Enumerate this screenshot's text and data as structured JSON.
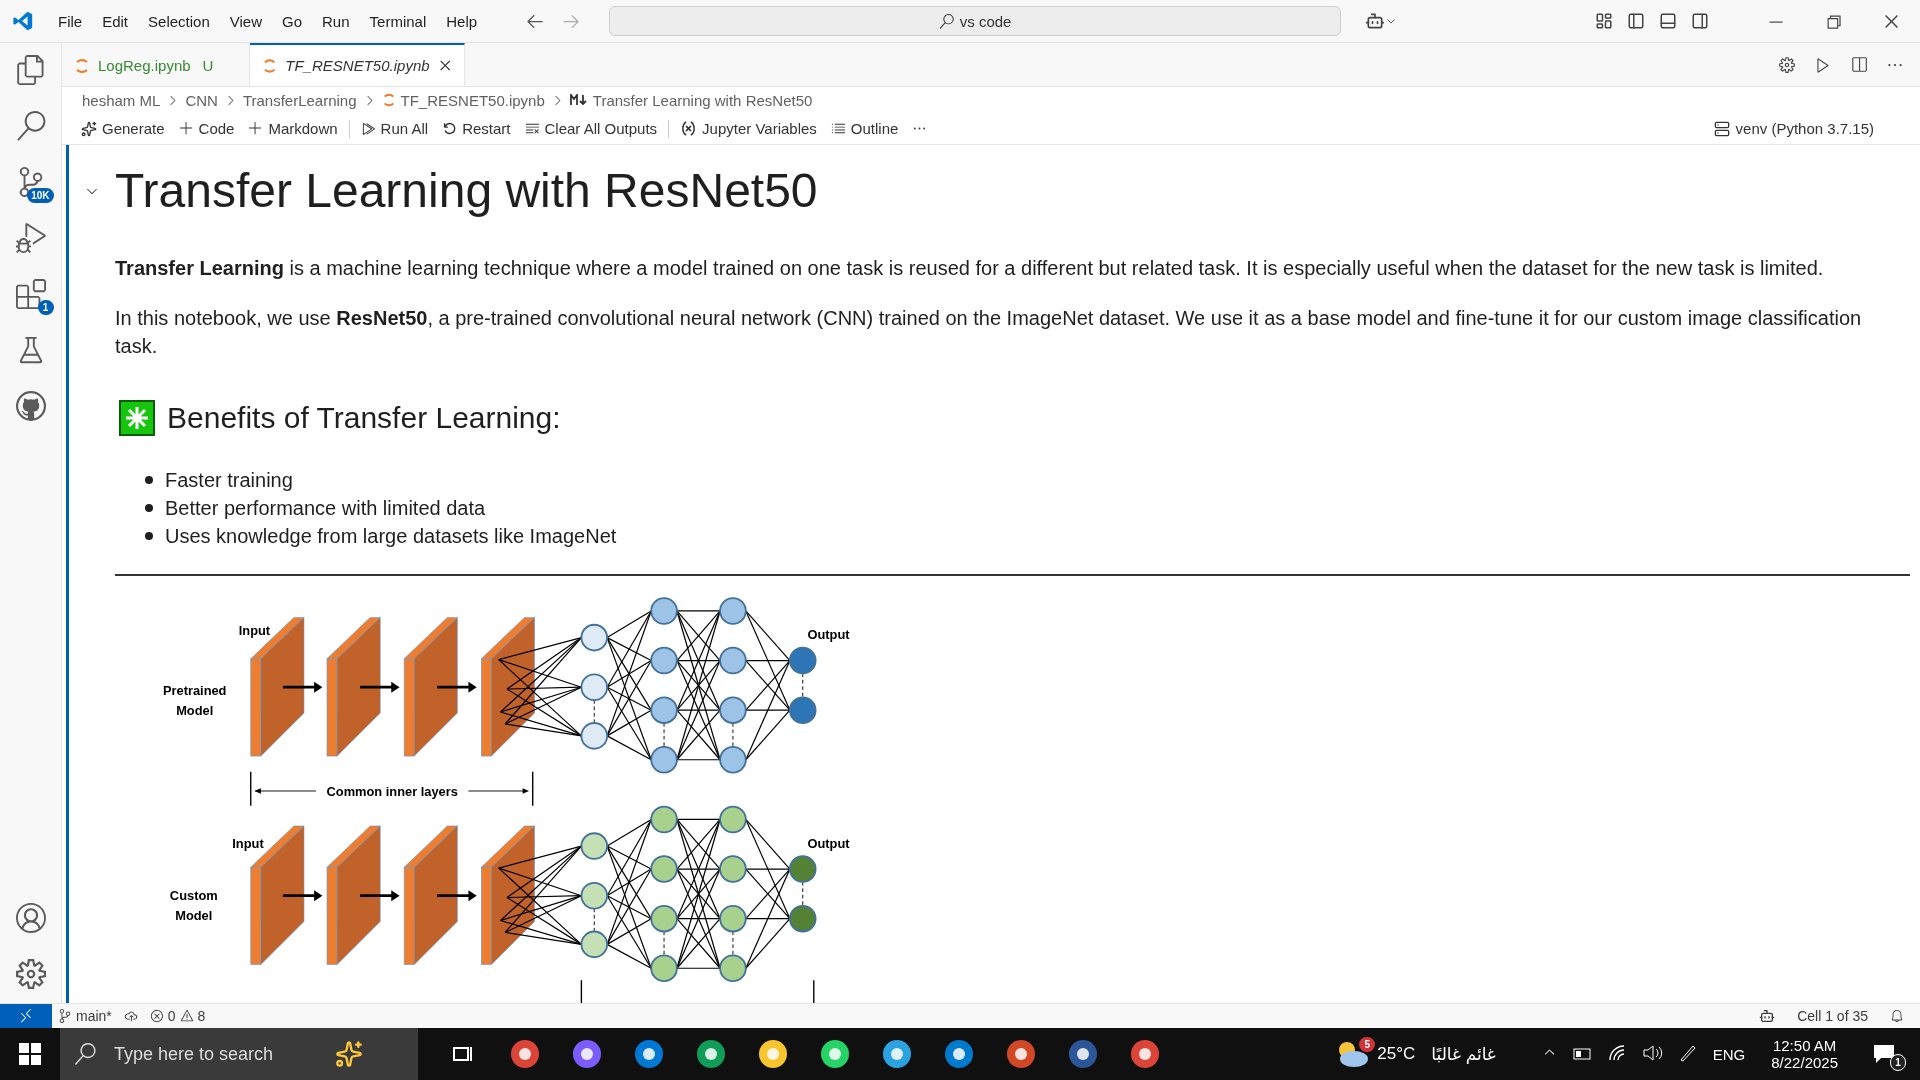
{
  "menu": [
    "File",
    "Edit",
    "Selection",
    "View",
    "Go",
    "Run",
    "Terminal",
    "Help"
  ],
  "command_center": {
    "value": "vs code"
  },
  "activity_badges": {
    "source_control": "10K",
    "extensions": "1"
  },
  "tabs": [
    {
      "label": "LogReg.ipynb",
      "badge": "U",
      "selected": false
    },
    {
      "label": "TF_RESNET50.ipynb",
      "selected": true
    }
  ],
  "breadcrumb": [
    "hesham ML",
    "CNN",
    "TransferLearning",
    "TF_RESNET50.ipynb",
    "Transfer Learning with ResNet50"
  ],
  "notebook_toolbar": [
    {
      "label": "Generate",
      "kind": "generate"
    },
    {
      "label": "Code",
      "kind": "add"
    },
    {
      "label": "Markdown",
      "kind": "add"
    },
    {
      "label": "Run All",
      "kind": "run"
    },
    {
      "label": "Restart",
      "kind": "restart"
    },
    {
      "label": "Clear All Outputs",
      "kind": "clear"
    },
    {
      "label": "Jupyter Variables",
      "kind": "variables"
    },
    {
      "label": "Outline",
      "kind": "outline"
    }
  ],
  "kernel": "venv (Python 3.7.15)",
  "cell": {
    "heading": "Transfer Learning with ResNet50",
    "paragraphs": [
      "**Transfer Learning** is a machine learning technique where a model trained on one task is reused for a different but related task. It is especially useful when the dataset for the new task is limited.",
      "In this notebook, we use **ResNet50**, a pre-trained convolutional neural network (CNN) trained on the ImageNet dataset. We use it as a base model and fine-tune it for our custom image classification task."
    ],
    "subheading": "Benefits of Transfer Learning:",
    "bullets": [
      "Faster training",
      "Better performance with limited data",
      "Uses knowledge from large datasets like ImageNet"
    ],
    "diagram": {
      "top": {
        "input": "Input",
        "model": [
          "Pretrained",
          "Model"
        ],
        "output": "Output"
      },
      "span": "Common inner layers",
      "bottom": {
        "input": "Input",
        "model": [
          "Custom",
          "Model"
        ],
        "output": "Output"
      }
    }
  },
  "status_bar": {
    "branch": "main*",
    "errors": "0",
    "warnings": "8",
    "cell": "Cell 1 of 35"
  },
  "taskbar": {
    "search_placeholder": "Type here to search",
    "weather_badge": "5",
    "temperature": "25°C",
    "weather": "غائم غالبًا",
    "language": "ENG",
    "time": "12:50 AM",
    "date": "8/22/2025",
    "notifications": "1"
  }
}
